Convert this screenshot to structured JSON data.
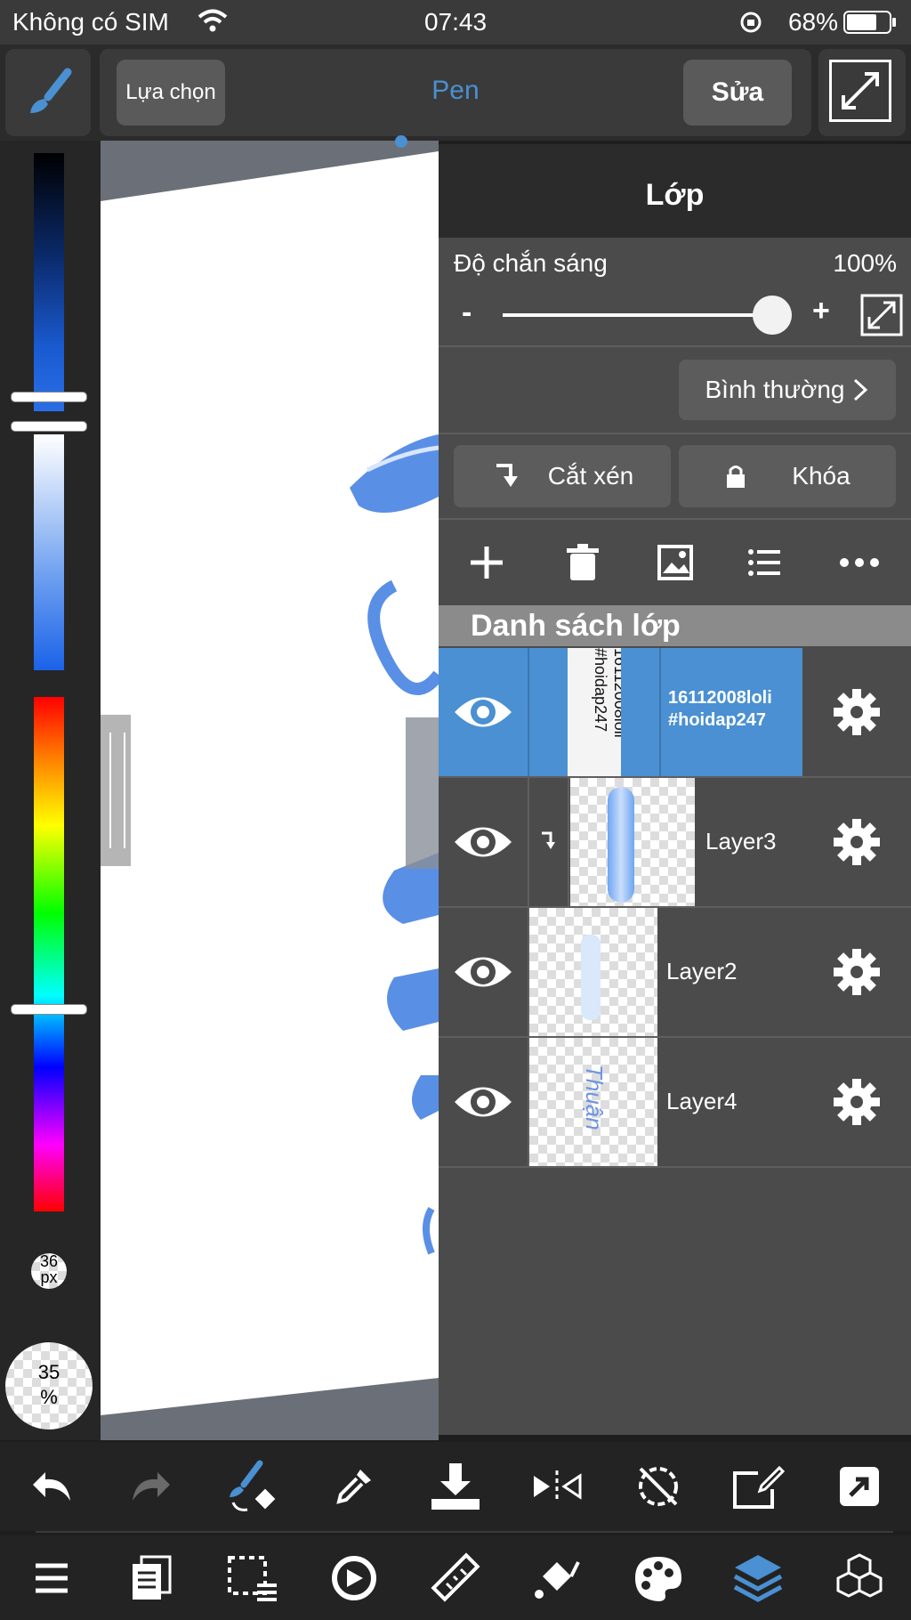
{
  "status_bar": {
    "carrier": "Không có SIM",
    "time": "07:43",
    "battery": "68%"
  },
  "toolbar": {
    "select_label": "Lựa chọn",
    "tool_name": "Pen",
    "edit_label": "Sửa"
  },
  "palette": {
    "brush_size": "36\npx",
    "opacity": "35\n%"
  },
  "layer_panel": {
    "title": "Lớp",
    "opacity_label": "Độ chắn sáng",
    "opacity_value": "100%",
    "opacity_level": 1.0,
    "minus": "-",
    "plus": "+",
    "blend_mode": "Bình thường",
    "clip_label": "Cắt xén",
    "lock_label": "Khóa",
    "list_title": "Danh sách lớp",
    "layers": [
      {
        "name": "16112008loli\n#hoidap247",
        "thumb_text": "16112008loli\n#hoidap247",
        "selected": true
      },
      {
        "name": "Layer3",
        "clipped": true
      },
      {
        "name": "Layer2"
      },
      {
        "name": "Layer4",
        "thumb_text": "Thuận"
      }
    ]
  },
  "colors": {
    "accent": "#4a90d2",
    "panel": "#4b4b4b",
    "bar": "#232323"
  },
  "icons": {
    "top": [
      "brush-icon",
      "fullscreen-icon"
    ],
    "panel": [
      "add-icon",
      "trash-icon",
      "image-icon",
      "list-icon",
      "more-icon",
      "expand-icon",
      "eye-icon",
      "gear-icon",
      "lock-icon",
      "clip-icon"
    ],
    "bottom_row1": [
      "undo-icon",
      "redo-icon",
      "brush-swap-icon",
      "eyedropper-icon",
      "download-icon",
      "flip-icon",
      "rotate-off-icon",
      "edit-frame-icon",
      "share-icon"
    ],
    "bottom_row2": [
      "menu-icon",
      "pages-icon",
      "selection-icon",
      "transform-icon",
      "ruler-icon",
      "fill-icon",
      "palette-icon",
      "layers-icon",
      "material-icon"
    ]
  }
}
